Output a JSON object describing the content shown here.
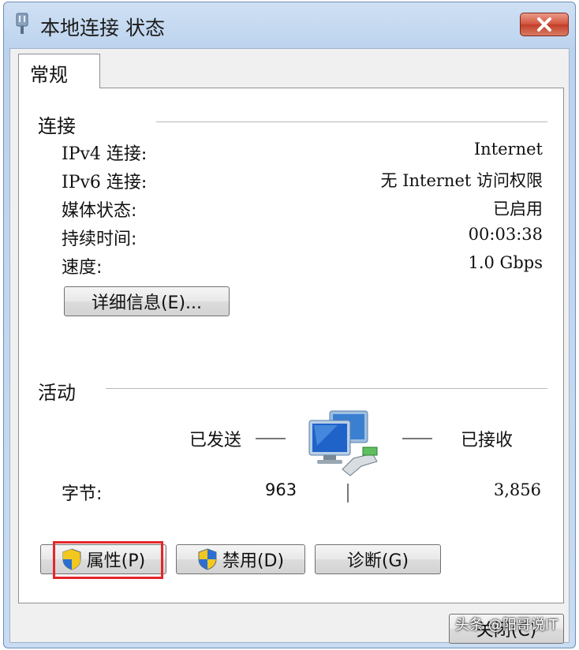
{
  "window": {
    "title": "本地连接 状态",
    "title_icon": "network-adapter-icon",
    "close_icon": "close-icon"
  },
  "tabs": [
    {
      "label": "常规",
      "selected": true
    }
  ],
  "connection": {
    "heading": "连接",
    "rows": [
      {
        "label": "IPv4 连接:",
        "value": "Internet"
      },
      {
        "label": "IPv6 连接:",
        "value": "无 Internet 访问权限"
      },
      {
        "label": "媒体状态:",
        "value": "已启用"
      },
      {
        "label": "持续时间:",
        "value": "00:03:38"
      },
      {
        "label": "速度:",
        "value": "1.0 Gbps"
      }
    ],
    "details_button": "详细信息(E)..."
  },
  "activity": {
    "heading": "活动",
    "sent_label": "已发送",
    "received_label": "已接收",
    "bytes_label": "字节:",
    "bytes_sent": "963",
    "bytes_received": "3,856",
    "icon": "network-computers-icon"
  },
  "buttons": {
    "properties": "属性(P)",
    "disable": "禁用(D)",
    "diagnose": "诊断(G)",
    "close": "关闭(C)",
    "shield_icon": "uac-shield-icon"
  },
  "watermark": "头条 @阳哥说IT",
  "colors": {
    "highlight": "#e4262b",
    "close_button": "#c23e28"
  }
}
